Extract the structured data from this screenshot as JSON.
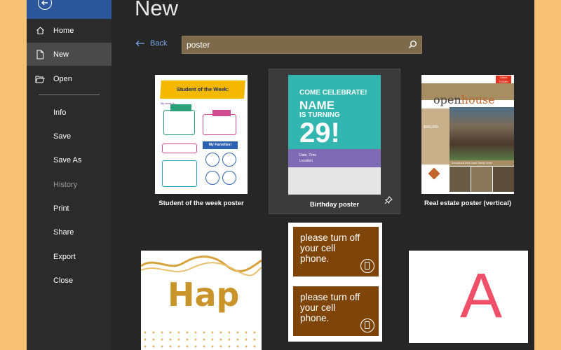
{
  "sidebar": {
    "items": [
      {
        "label": "Home"
      },
      {
        "label": "New"
      },
      {
        "label": "Open"
      },
      {
        "label": "Info"
      },
      {
        "label": "Save"
      },
      {
        "label": "Save As"
      },
      {
        "label": "History"
      },
      {
        "label": "Print"
      },
      {
        "label": "Share"
      },
      {
        "label": "Export"
      },
      {
        "label": "Close"
      }
    ]
  },
  "main": {
    "title": "New",
    "back_label": "Back",
    "search_value": "poster"
  },
  "templates": [
    {
      "caption": "Student of the week poster",
      "content": {
        "banner": "Student of the Week:",
        "line": "My week is...",
        "favorites": "My Favorites!"
      }
    },
    {
      "caption": "Birthday poster",
      "content": {
        "line1": "COME CELEBRATE!",
        "line2": "NAME",
        "line3": "IS TURNING",
        "number": "29!",
        "date": "Date, Time",
        "location": "Location"
      }
    },
    {
      "caption": "Real estate poster (vertical)",
      "content": {
        "word_a": "open",
        "word_b": "house",
        "price": "$000,000",
        "caption": "Exceptional Multi-Level Family Home",
        "badge_line1": "Listed",
        "badge_line2": "TODAY"
      }
    },
    {
      "caption": "",
      "content": {
        "text": "Hap"
      }
    },
    {
      "caption": "",
      "content": {
        "message1": "please turn off your cell phone.",
        "message2": "please turn off your cell phone."
      }
    },
    {
      "caption": "",
      "content": {
        "letter": "A"
      }
    }
  ],
  "colors": {
    "background": "#f7c276",
    "sidebar": "#2b2b2b",
    "accent": "#2b579a",
    "search_bg": "#7c6a4b",
    "link": "#79a8e8"
  }
}
